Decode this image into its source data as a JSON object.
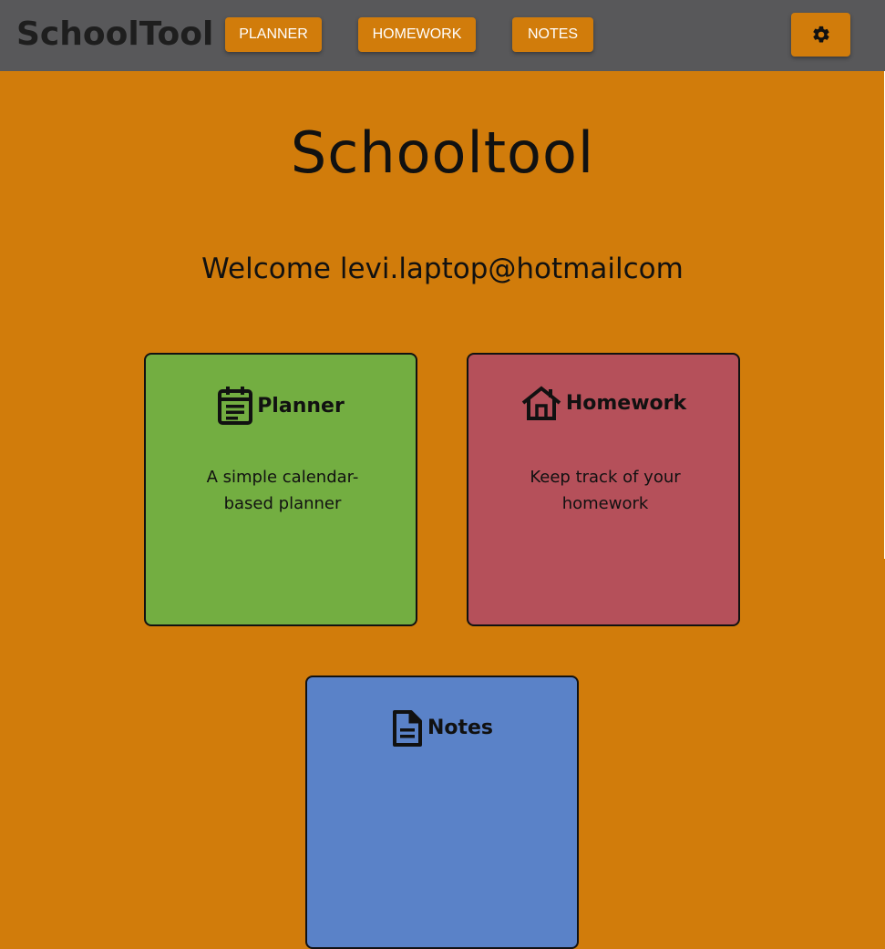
{
  "header": {
    "logo": "SchoolTool",
    "nav": [
      {
        "label": "PLANNER"
      },
      {
        "label": "HOMEWORK"
      },
      {
        "label": "NOTES"
      }
    ],
    "settings_icon": "gear-icon"
  },
  "main": {
    "title": "Schooltool",
    "welcome": "Welcome levi.laptop@hotmailcom",
    "cards": [
      {
        "title": "Planner",
        "description": "A simple calendar-based planner",
        "icon": "calendar-icon",
        "color": "#73ae41"
      },
      {
        "title": "Homework",
        "description": "Keep track of your homework",
        "icon": "house-icon",
        "color": "#b5505a"
      },
      {
        "title": "Notes",
        "description": "",
        "icon": "document-icon",
        "color": "#5a82c8"
      }
    ]
  },
  "colors": {
    "background": "#d17c0b",
    "topbar": "#58585a",
    "button": "#d17c0b"
  }
}
